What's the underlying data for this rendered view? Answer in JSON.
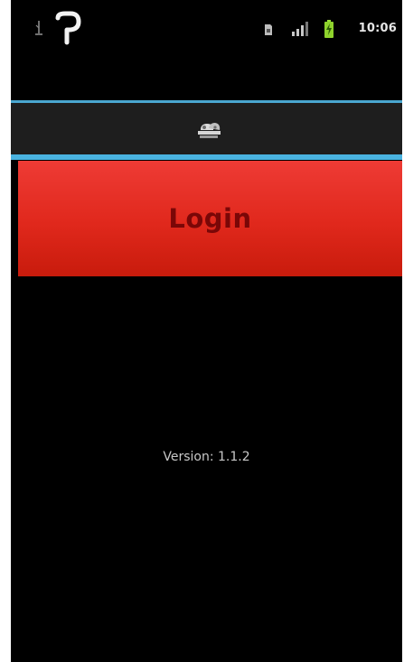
{
  "status_bar": {
    "time": "10:06",
    "icons": [
      "usb-debug-icon",
      "notification-p-icon",
      "sim-card-icon",
      "signal-icon",
      "battery-charging-icon"
    ]
  },
  "action_bar": {
    "icon": "app-logo-icon",
    "divider_color": "#4ab3e0"
  },
  "main": {
    "login_label": "Login",
    "login_color": "#e0281c",
    "version_text": "Version: 1.1.2"
  }
}
